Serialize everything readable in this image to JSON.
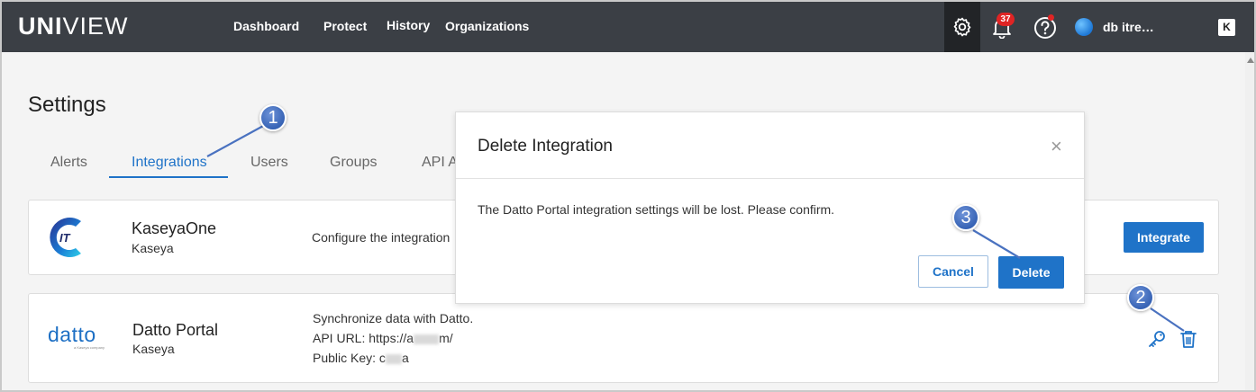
{
  "header": {
    "logo_bold": "UNI",
    "logo_thin": "VIEW",
    "nav": [
      "Dashboard",
      "Protect",
      "History",
      "Organizations"
    ],
    "notification_count": "37",
    "user_name": "db          itre…",
    "kaseya_badge": "K"
  },
  "page": {
    "title": "Settings",
    "tabs": [
      "Alerts",
      "Integrations",
      "Users",
      "Groups",
      "API A"
    ],
    "active_tab": "Integrations"
  },
  "integrations": [
    {
      "name": "KaseyaOne",
      "vendor": "Kaseya",
      "description": "Configure the integration ",
      "action_label": "Integrate"
    },
    {
      "name": "Datto Portal",
      "vendor": "Kaseya",
      "logo_text": "datto",
      "logo_subtext": "a Kaseya company",
      "desc_line1": "Synchronize data with Datto.",
      "api_url_prefix": "API URL: https://a",
      "api_url_suffix": "m/",
      "public_key_prefix": "Public Key: c",
      "public_key_suffix": "a"
    }
  ],
  "modal": {
    "title": "Delete Integration",
    "close_glyph": "×",
    "body": "The Datto Portal integration settings will be lost. Please confirm.",
    "cancel_label": "Cancel",
    "delete_label": "Delete"
  },
  "callouts": [
    "1",
    "2",
    "3"
  ],
  "colors": {
    "topbar": "#3b3f45",
    "accent": "#1f73c8",
    "badge": "#e02424",
    "callout": "#3763b5"
  }
}
